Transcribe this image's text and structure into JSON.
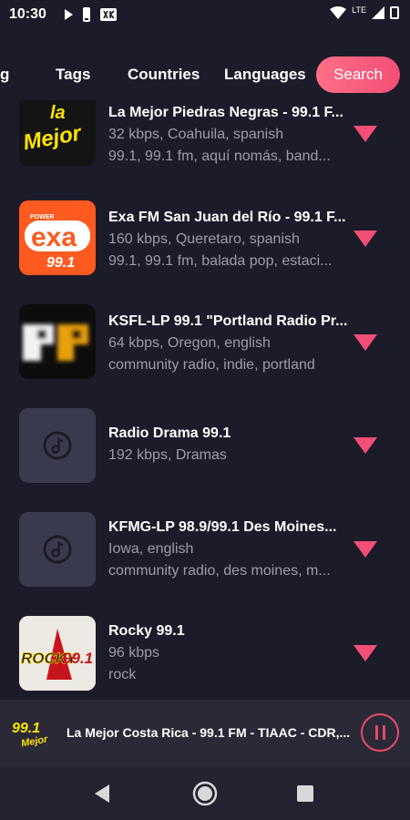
{
  "status_bar": {
    "time": "10:30",
    "network": "LTE"
  },
  "tabs": {
    "partial_label": "g",
    "items": [
      "Tags",
      "Countries",
      "Languages"
    ],
    "active": "Search"
  },
  "stations": [
    {
      "name": "La Mejor Piedras Negras - 99.1 F...",
      "info": "32 kbps, Coahuila, spanish",
      "tags": "99.1, 99.1 fm, aquí nomás, band..."
    },
    {
      "name": "Exa FM San Juan del Río - 99.1 F...",
      "info": "160 kbps, Queretaro, spanish",
      "tags": "99.1, 99.1 fm, balada pop, estaci..."
    },
    {
      "name": "KSFL-LP 99.1 \"Portland Radio Pr...",
      "info": "64 kbps, Oregon, english",
      "tags": "community radio, indie, portland"
    },
    {
      "name": "Radio Drama 99.1",
      "info": "192 kbps, Dramas",
      "tags": ""
    },
    {
      "name": "KFMG-LP 98.9/99.1  Des Moines...",
      "info": "Iowa, english",
      "tags": "community radio, des moines, m..."
    },
    {
      "name": "Rocky 99.1",
      "info": "96 kbps",
      "tags": "rock"
    }
  ],
  "logos": {
    "la_mejor": {
      "line1": "la",
      "line2": "Mejor"
    },
    "exa": {
      "top": "POWER",
      "main": "exa",
      "freq": "99.1"
    },
    "rocky": {
      "main": "ROCKY",
      "freq": "99.1"
    },
    "player": {
      "freq": "99.1",
      "sub": "Mejor"
    }
  },
  "player": {
    "title": "La Mejor Costa Rica - 99.1 FM - TIAAC - CDR,...",
    "state": "playing"
  },
  "colors": {
    "background": "#1c1b29",
    "accent": "#f24f77",
    "secondary_text": "#9c9cab",
    "player_bg": "#2a2937"
  },
  "icons": {
    "favorite": "heart-icon",
    "generic_logo": "music-note-icon",
    "pause": "pause-icon",
    "nav": [
      "back-icon",
      "home-icon",
      "recents-icon"
    ]
  }
}
